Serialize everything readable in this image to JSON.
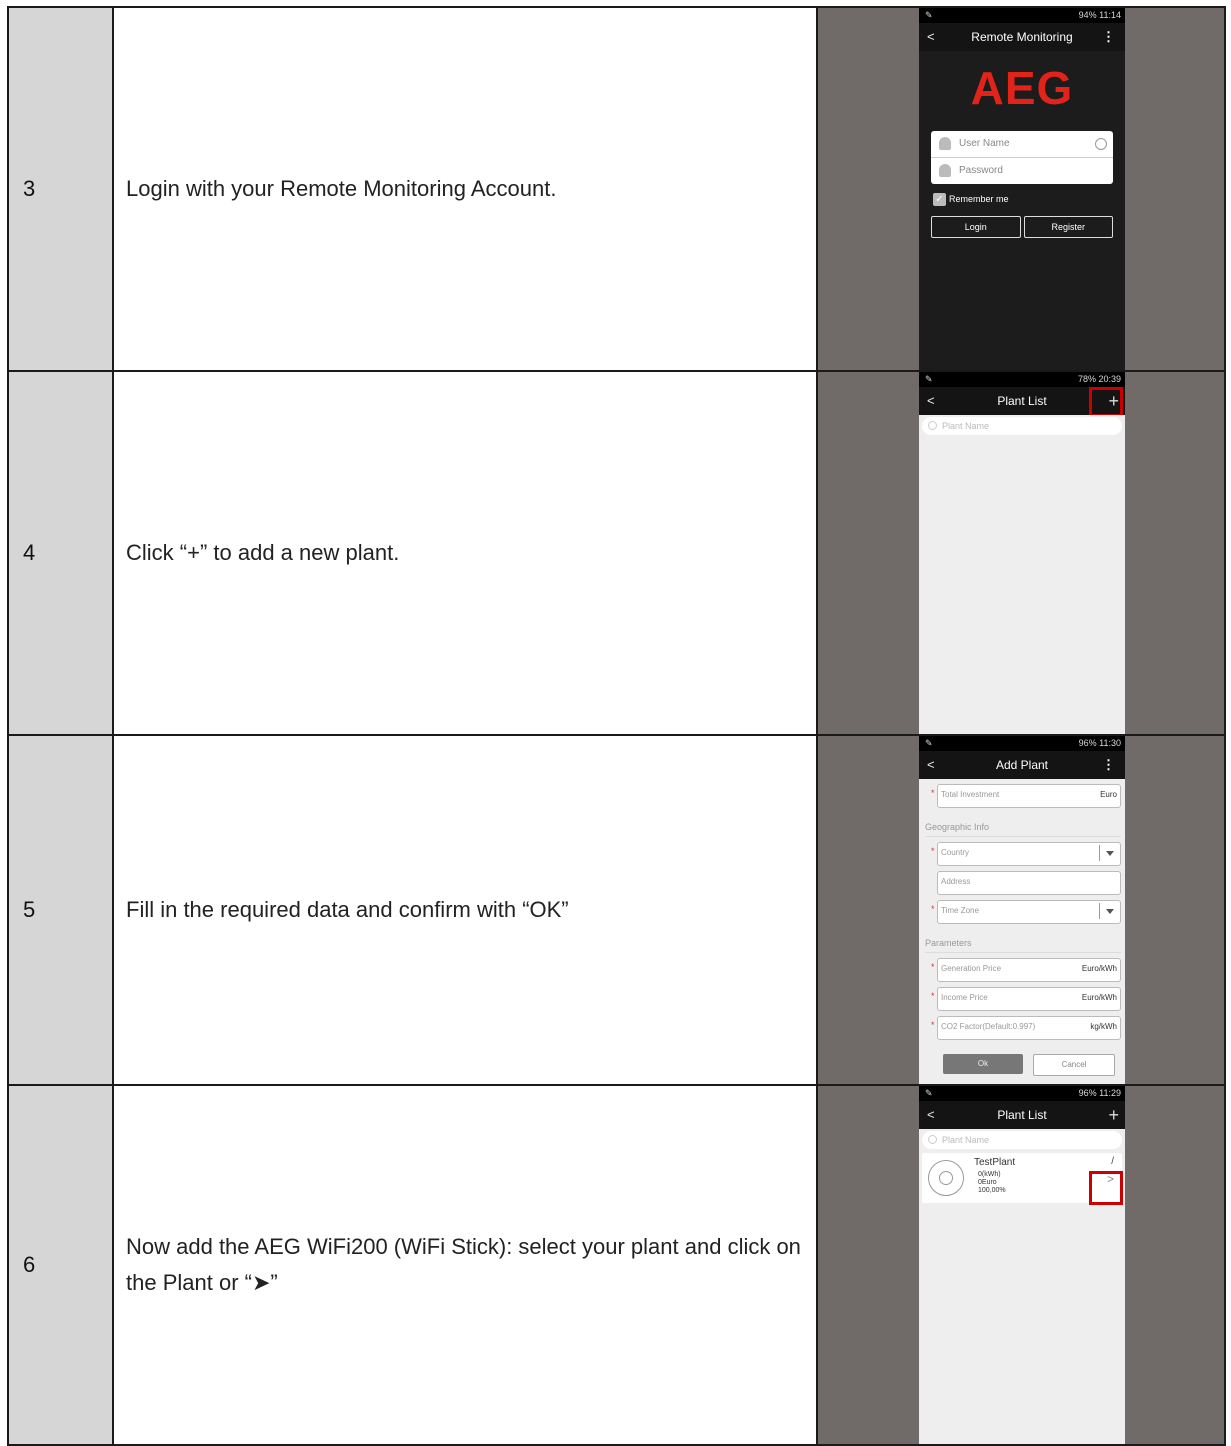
{
  "steps": [
    {
      "num": "3",
      "text": "Login with your Remote Monitoring Account."
    },
    {
      "num": "4",
      "text": "Click “+” to add a new plant."
    },
    {
      "num": "5",
      "text": "Fill in the required data and confirm with “OK”"
    },
    {
      "num": "6",
      "text": "Now add the AEG WiFi200 (WiFi Stick): select your plant and click on the Plant or “➤”"
    }
  ],
  "screen_login": {
    "status": "94% 11:14",
    "title": "Remote Monitoring",
    "logo": "AEG",
    "username_placeholder": "User Name",
    "password_placeholder": "Password",
    "remember": "Remember me",
    "login": "Login",
    "register": "Register"
  },
  "screen_plantlist_empty": {
    "status": "78% 20:39",
    "title": "Plant List",
    "plus": "+",
    "search_placeholder": "Plant Name"
  },
  "screen_addplant": {
    "status": "96% 11:30",
    "title": "Add Plant",
    "total_investment": "Total Investment",
    "euro": "Euro",
    "geo_section": "Geographic Info",
    "country": "Country",
    "address": "Address",
    "time_zone": "Time Zone",
    "params_section": "Parameters",
    "generation_price": "Generation Price",
    "income_price": "Income Price",
    "unit_price": "Euro/kWh",
    "co2_factor": "CO2 Factor(Default:0.997)",
    "co2_unit": "kg/kWh",
    "ok": "Ok",
    "cancel": "Cancel"
  },
  "screen_plantlist_filled": {
    "status": "96% 11:29",
    "title": "Plant List",
    "plus": "+",
    "search_placeholder": "Plant Name",
    "plant_name": "TestPlant",
    "energy": "0(kWh)",
    "income": "0Euro",
    "percent": "100,00%",
    "chevron": ">"
  }
}
